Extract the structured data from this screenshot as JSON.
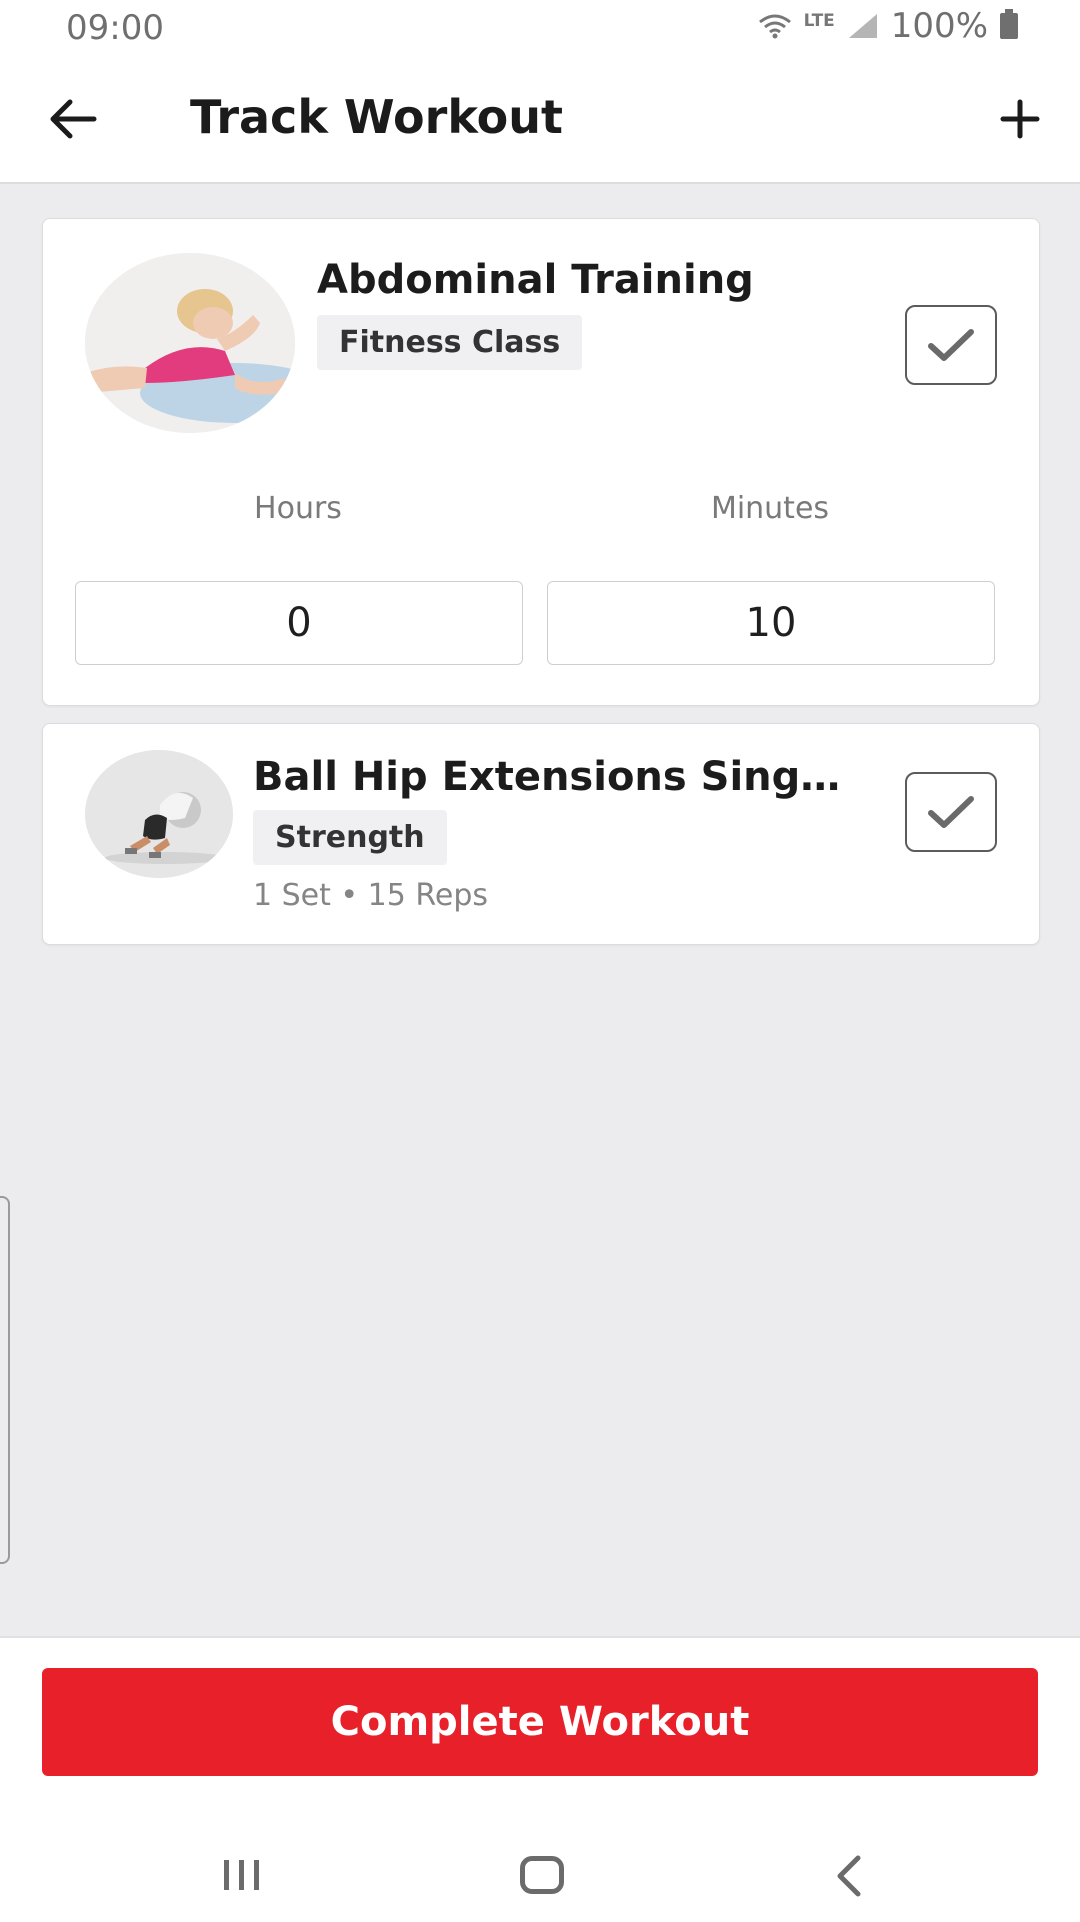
{
  "status_bar": {
    "time": "09:00",
    "network": "LTE",
    "battery": "100%"
  },
  "app_bar": {
    "title": "Track Workout"
  },
  "exercises": [
    {
      "name": "Abdominal Training",
      "category": "Fitness Class",
      "checked": true,
      "duration": {
        "hours_label": "Hours",
        "minutes_label": "Minutes",
        "hours": "0",
        "minutes": "10"
      }
    },
    {
      "name": "Ball Hip Extensions Single...",
      "category": "Strength",
      "checked": true,
      "meta": "1 Set • 15 Reps"
    }
  ],
  "footer": {
    "complete_label": "Complete Workout"
  },
  "colors": {
    "accent": "#e8202a",
    "background": "#ecebee"
  },
  "icons": {
    "back": "arrow-left-icon",
    "add": "plus-icon",
    "check": "check-icon"
  }
}
